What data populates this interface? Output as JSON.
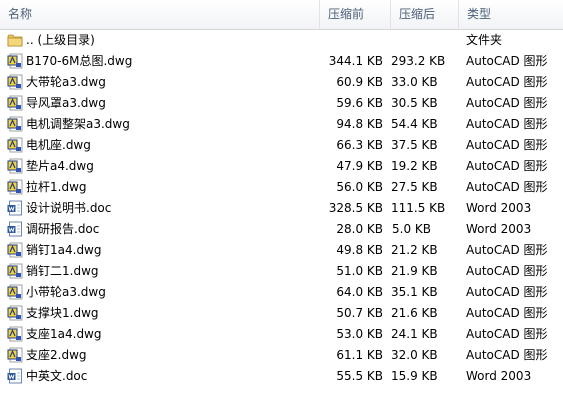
{
  "columns": {
    "name": "名称",
    "packed": "压缩前",
    "original": "压缩后",
    "type": "类型"
  },
  "rows": [
    {
      "name": ".. (上级目录)",
      "packed": "",
      "original": "",
      "type": "文件夹",
      "icon": "folder-icon"
    },
    {
      "name": "B170-6M总图.dwg",
      "packed": "344.1 KB",
      "original": "293.2 KB",
      "type": "AutoCAD 图形",
      "icon": "autocad-file-icon"
    },
    {
      "name": "大带轮a3.dwg",
      "packed": "60.9 KB",
      "original": "33.0 KB",
      "type": "AutoCAD 图形",
      "icon": "autocad-file-icon"
    },
    {
      "name": "导风罩a3.dwg",
      "packed": "59.6 KB",
      "original": "30.5 KB",
      "type": "AutoCAD 图形",
      "icon": "autocad-file-icon"
    },
    {
      "name": "电机调整架a3.dwg",
      "packed": "94.8 KB",
      "original": "54.4 KB",
      "type": "AutoCAD 图形",
      "icon": "autocad-file-icon"
    },
    {
      "name": "电机座.dwg",
      "packed": "66.3 KB",
      "original": "37.5 KB",
      "type": "AutoCAD 图形",
      "icon": "autocad-file-icon"
    },
    {
      "name": "垫片a4.dwg",
      "packed": "47.9 KB",
      "original": "19.2 KB",
      "type": "AutoCAD 图形",
      "icon": "autocad-file-icon"
    },
    {
      "name": "拉杆1.dwg",
      "packed": "56.0 KB",
      "original": "27.5 KB",
      "type": "AutoCAD 图形",
      "icon": "autocad-file-icon"
    },
    {
      "name": "设计说明书.doc",
      "packed": "328.5 KB",
      "original": "111.5 KB",
      "type": "Word 2003",
      "icon": "word-file-icon"
    },
    {
      "name": "调研报告.doc",
      "packed": "28.0 KB",
      "original": "5.0 KB",
      "type": "Word 2003",
      "icon": "word-file-icon"
    },
    {
      "name": "销钉1a4.dwg",
      "packed": "49.8 KB",
      "original": "21.2 KB",
      "type": "AutoCAD 图形",
      "icon": "autocad-file-icon"
    },
    {
      "name": "销钉二1.dwg",
      "packed": "51.0 KB",
      "original": "21.9 KB",
      "type": "AutoCAD 图形",
      "icon": "autocad-file-icon"
    },
    {
      "name": "小带轮a3.dwg",
      "packed": "64.0 KB",
      "original": "35.1 KB",
      "type": "AutoCAD 图形",
      "icon": "autocad-file-icon"
    },
    {
      "name": "支撑块1.dwg",
      "packed": "50.7 KB",
      "original": "21.6 KB",
      "type": "AutoCAD 图形",
      "icon": "autocad-file-icon"
    },
    {
      "name": "支座1a4.dwg",
      "packed": "53.0 KB",
      "original": "24.1 KB",
      "type": "AutoCAD 图形",
      "icon": "autocad-file-icon"
    },
    {
      "name": "支座2.dwg",
      "packed": "61.1 KB",
      "original": "32.0 KB",
      "type": "AutoCAD 图形",
      "icon": "autocad-file-icon"
    },
    {
      "name": "中英文.doc",
      "packed": "55.5 KB",
      "original": "15.9 KB",
      "type": "Word 2003",
      "icon": "word-file-icon"
    }
  ]
}
